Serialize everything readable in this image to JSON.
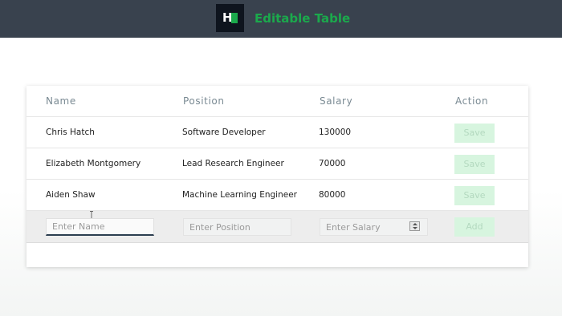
{
  "header": {
    "title": "Editable Table",
    "logo_letter": "H"
  },
  "table": {
    "columns": [
      "Name",
      "Position",
      "Salary",
      "Action"
    ],
    "rows": [
      {
        "name": "Chris Hatch",
        "position": "Software Developer",
        "salary": "130000",
        "action": "Save"
      },
      {
        "name": "Elizabeth Montgomery",
        "position": "Lead Research Engineer",
        "salary": "70000",
        "action": "Save"
      },
      {
        "name": "Aiden Shaw",
        "position": "Machine Learning Engineer",
        "salary": "80000",
        "action": "Save"
      }
    ],
    "form": {
      "name_placeholder": "Enter Name",
      "position_placeholder": "Enter Position",
      "salary_placeholder": "Enter Salary",
      "add_label": "Add"
    }
  },
  "colors": {
    "topbar": "#39424e",
    "brand_green": "#1ba94c",
    "button_bg": "#d7f5df"
  }
}
